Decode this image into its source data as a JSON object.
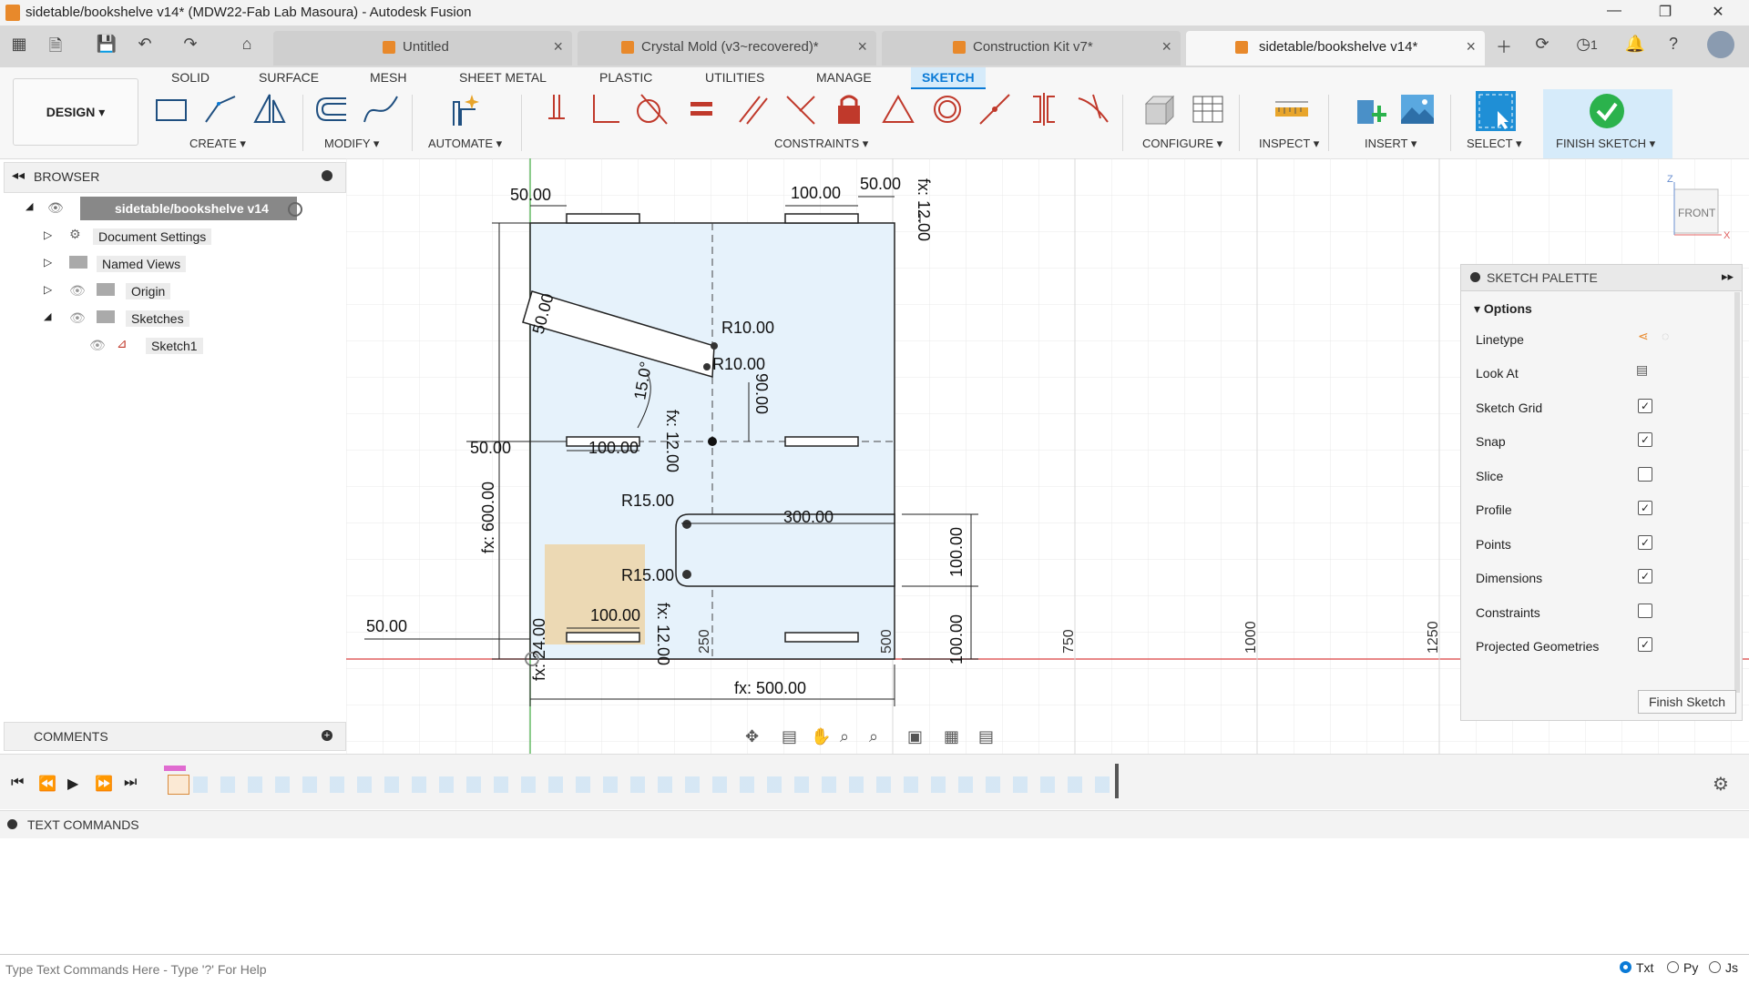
{
  "window": {
    "title": "sidetable/bookshelve v14* (MDW22-Fab Lab Masoura) - Autodesk Fusion",
    "minimize": "—",
    "maximize": "❐",
    "close": "✕"
  },
  "tabs": [
    {
      "label": "Untitled"
    },
    {
      "label": "Crystal Mold (v3~recovered)*"
    },
    {
      "label": "Construction Kit v7*"
    },
    {
      "label": "sidetable/bookshelve v14*",
      "active": true
    }
  ],
  "quickaccess": {
    "jobs_count": "1"
  },
  "toolbar": {
    "workspace": "DESIGN ▾",
    "workspace_tabs": [
      "SOLID",
      "SURFACE",
      "MESH",
      "SHEET METAL",
      "PLASTIC",
      "UTILITIES",
      "MANAGE",
      "SKETCH"
    ],
    "groups": {
      "create": "CREATE ▾",
      "modify": "MODIFY ▾",
      "automate": "AUTOMATE ▾",
      "constraints": "CONSTRAINTS ▾",
      "configure": "CONFIGURE ▾",
      "inspect": "INSPECT ▾",
      "insert": "INSERT ▾",
      "select": "SELECT ▾",
      "finish": "FINISH SKETCH ▾"
    }
  },
  "browser": {
    "title": "BROWSER",
    "root": "sidetable/bookshelve v14",
    "items": [
      "Document Settings",
      "Named Views",
      "Origin",
      "Sketches",
      "Sketch1"
    ]
  },
  "comments": {
    "title": "COMMENTS"
  },
  "viewcube": {
    "face": "FRONT",
    "z": "Z",
    "x": "X"
  },
  "sketch": {
    "dims": {
      "top_left_50": "50.00",
      "top_100": "100.00",
      "top_right_50": "50.00",
      "fx12_top": "fx: 12.00",
      "slot_50": "50.00",
      "r10_a": "R10.00",
      "r10_b": "R10.00",
      "angle": "15.0°",
      "d90": "90.00",
      "mid_50": "50.00",
      "mid_100": "100.00",
      "fx12_mid": "fx: 12.00",
      "height": "fx: 600.00",
      "r15_a": "R15.00",
      "d300": "300.00",
      "d100_right": "100.00",
      "r15_b": "R15.00",
      "bot_100": "100.00",
      "fx12_bot": "fx: 12.00",
      "bot_50": "50.00",
      "fx24": "fx: 24.00",
      "d100_right2": "100.00",
      "width": "fx: 500.00"
    },
    "axis_ticks": [
      "250",
      "500",
      "750",
      "1000",
      "1250"
    ]
  },
  "palette": {
    "title": "SKETCH PALETTE",
    "section": "Options",
    "rows": [
      {
        "label": "Linetype",
        "type": "icons"
      },
      {
        "label": "Look At",
        "type": "icon"
      },
      {
        "label": "Sketch Grid",
        "checked": true
      },
      {
        "label": "Snap",
        "checked": true
      },
      {
        "label": "Slice",
        "checked": false
      },
      {
        "label": "Profile",
        "checked": true
      },
      {
        "label": "Points",
        "checked": true
      },
      {
        "label": "Dimensions",
        "checked": true
      },
      {
        "label": "Constraints",
        "checked": false
      },
      {
        "label": "Projected Geometries",
        "checked": true
      }
    ],
    "finish_button": "Finish Sketch"
  },
  "textcommands": {
    "title": "TEXT COMMANDS",
    "placeholder": "Type Text Commands Here - Type '?' For Help",
    "modes": [
      "Txt",
      "Py",
      "Js"
    ]
  },
  "colors": {
    "accent": "#0a7ad6",
    "sketch_fill": "#e6f2fb",
    "profile_highlight": "#ecd9b4",
    "axis_red": "#e06060",
    "axis_green": "#66bb66",
    "finish_green": "#2bb24c"
  }
}
